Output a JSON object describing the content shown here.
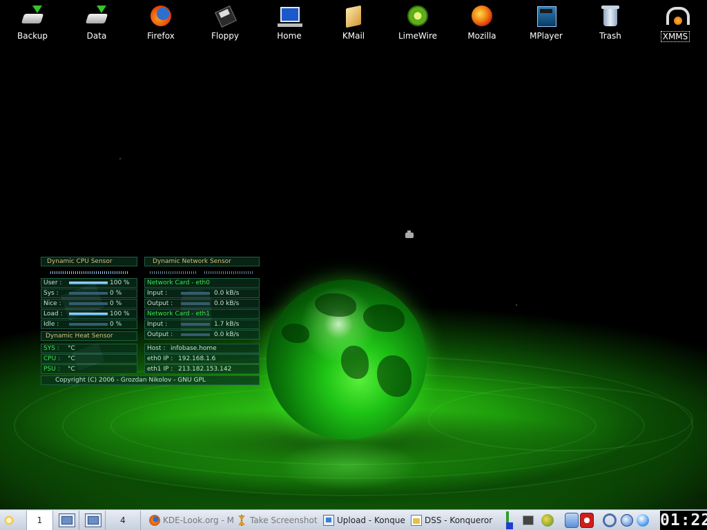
{
  "desktop": {
    "icons": [
      {
        "label": "Backup",
        "icon": "drive-backup-icon"
      },
      {
        "label": "Data",
        "icon": "drive-data-icon"
      },
      {
        "label": "Firefox",
        "icon": "firefox-icon"
      },
      {
        "label": "Floppy",
        "icon": "floppy-icon"
      },
      {
        "label": "Home",
        "icon": "home-computer-icon"
      },
      {
        "label": "KMail",
        "icon": "kmail-icon"
      },
      {
        "label": "LimeWire",
        "icon": "limewire-icon"
      },
      {
        "label": "Mozilla",
        "icon": "mozilla-icon"
      },
      {
        "label": "MPlayer",
        "icon": "mplayer-icon"
      },
      {
        "label": "Trash",
        "icon": "trash-icon"
      },
      {
        "label": "XMMS",
        "icon": "xmms-headphones-icon"
      }
    ],
    "selected_icon": "XMMS"
  },
  "cpu_sensor": {
    "title": "Dynamic CPU Sensor",
    "rows": [
      {
        "label": "User :",
        "value": "100 %",
        "level": 100
      },
      {
        "label": "Sys :",
        "value": "0 %",
        "level": 0
      },
      {
        "label": "Nice :",
        "value": "0 %",
        "level": 0
      },
      {
        "label": "Load :",
        "value": "100 %",
        "level": 100
      },
      {
        "label": "Idle :",
        "value": "0 %",
        "level": 0
      }
    ]
  },
  "heat_sensor": {
    "title": "Dynamic Heat Sensor",
    "rows": [
      {
        "label": "SYS :",
        "value": "°C"
      },
      {
        "label": "CPU :",
        "value": "°C"
      },
      {
        "label": "PSU :",
        "value": "°C"
      }
    ]
  },
  "network_sensor": {
    "title": "Dynamic Network Sensor",
    "eth0": {
      "title": "Network Card - eth0",
      "input_label": "Input :",
      "input_value": "0.0 kB/s",
      "output_label": "Output :",
      "output_value": "0.0 kB/s"
    },
    "eth1": {
      "title": "Network Card - eth1",
      "input_label": "Input :",
      "input_value": "1.7 kB/s",
      "output_label": "Output :",
      "output_value": "0.0 kB/s"
    },
    "host": {
      "label": "Host :",
      "value": "infobase.home"
    },
    "eth0_ip": {
      "label": "eth0 IP :",
      "value": "192.168.1.6"
    },
    "eth1_ip": {
      "label": "eth1 IP :",
      "value": "213.182.153.142"
    }
  },
  "copyright": "Copyright (C) 2006 - Grozdan Nikolov - GNU GPL",
  "taskbar": {
    "desktops": [
      {
        "label": "1",
        "active": true
      },
      {
        "label": "",
        "icon": "window-thumbnail-icon"
      },
      {
        "label": "",
        "icon": "window-thumbnail-icon"
      },
      {
        "label": "4",
        "active": false
      }
    ],
    "tasks": [
      {
        "label": "KDE-Look.org - M",
        "icon": "firefox-icon",
        "dimmed": true
      },
      {
        "label": "Take Screenshot",
        "icon": "hourglass-icon",
        "dimmed": true
      },
      {
        "label": "Upload - Konque",
        "icon": "konqueror-upload-icon",
        "dimmed": false
      },
      {
        "label": "DSS - Konqueror",
        "icon": "konqueror-folder-icon",
        "dimmed": false
      }
    ],
    "tray": [
      "system-load-icon",
      "terminal-icon",
      "kget-icon",
      "lock-screen-icon",
      "logout-icon",
      "search-icon",
      "konqueror-globe-icon",
      "weather-icon"
    ],
    "clock": "01:22"
  },
  "colors": {
    "accent_green": "#38e84a",
    "widget_title": "#d8c27a",
    "widget_text": "#c4e4d6",
    "widget_bg": "#08301c",
    "taskbar_bg": "#dfe5ef"
  }
}
